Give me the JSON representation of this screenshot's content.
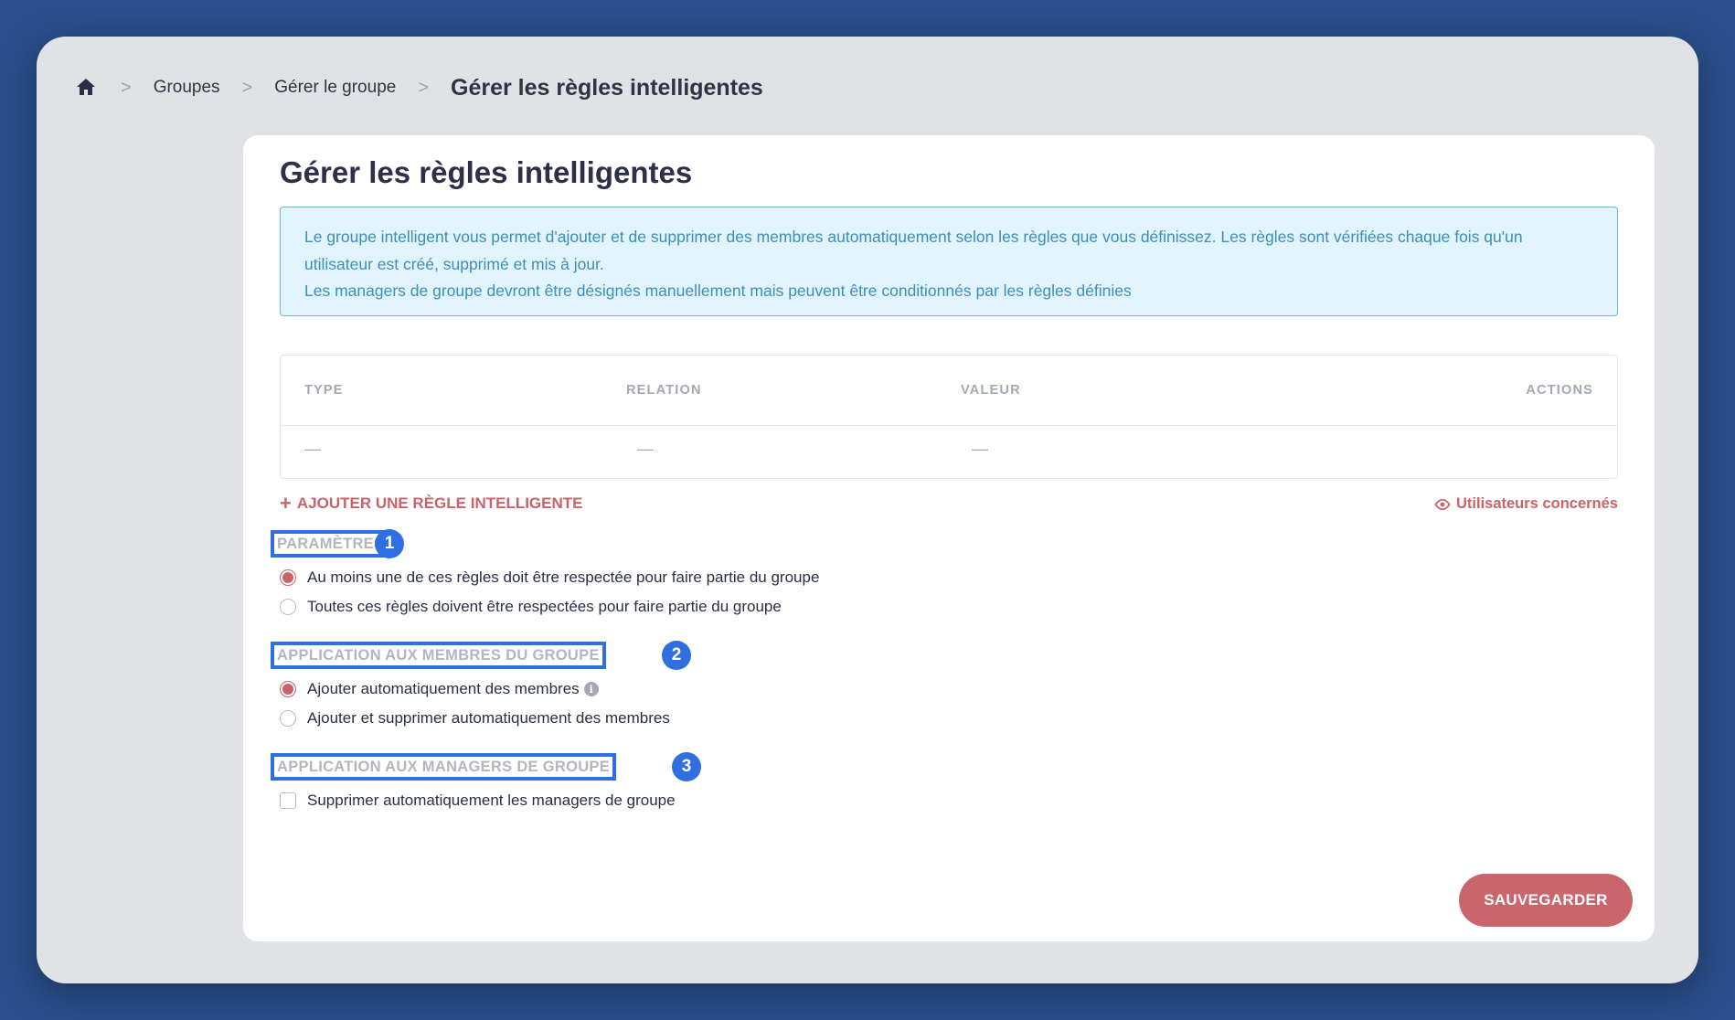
{
  "breadcrumb": {
    "items": [
      "Groupes",
      "Gérer le groupe"
    ],
    "current": "Gérer les règles intelligentes",
    "separator": ">"
  },
  "page": {
    "title": "Gérer les règles intelligentes",
    "info_lines": [
      "Le groupe intelligent vous permet d'ajouter et de supprimer des membres automatiquement selon les règles que vous définissez. Les règles sont vérifiées chaque fois qu'un utilisateur est créé, supprimé et mis à jour.",
      "Les managers de groupe devront être désignés manuellement mais peuvent être conditionnés par les règles définies"
    ]
  },
  "table": {
    "headers": [
      "TYPE",
      "RELATION",
      "VALEUR",
      "ACTIONS"
    ],
    "empty_row": [
      "—",
      "—",
      "—"
    ]
  },
  "actions": {
    "add_rule": "+ AJOUTER UNE RÈGLE INTELLIGENTE",
    "add_rule_text": "AJOUTER UNE RÈGLE INTELLIGENTE",
    "users_concerned": "Utilisateurs concernés",
    "save": "SAUVEGARDER"
  },
  "sections": [
    {
      "label": "PARAMÈTRES",
      "badge": "1",
      "options": [
        {
          "type": "radio",
          "label": "Au moins une de ces règles doit être respectée pour faire partie du groupe",
          "checked": true
        },
        {
          "type": "radio",
          "label": "Toutes ces règles doivent être respectées pour faire partie du groupe",
          "checked": false
        }
      ]
    },
    {
      "label": "APPLICATION AUX MEMBRES DU GROUPE",
      "badge": "2",
      "options": [
        {
          "type": "radio",
          "label": "Ajouter automatiquement des membres",
          "checked": true,
          "info_icon": true
        },
        {
          "type": "radio",
          "label": "Ajouter et supprimer automatiquement des membres",
          "checked": false
        }
      ]
    },
    {
      "label": "APPLICATION AUX MANAGERS DE GROUPE",
      "badge": "3",
      "options": [
        {
          "type": "checkbox",
          "label": "Supprimer automatiquement les managers de groupe",
          "checked": false
        }
      ]
    }
  ],
  "colors": {
    "background": "#2b4f8c",
    "window": "#e1e2e5",
    "accent": "#c9636a",
    "highlight": "#2f6fe0",
    "info_bg": "#e2f4fb",
    "info_text": "#3c8fb8"
  },
  "icons": [
    "home-icon",
    "chevron-right-icon",
    "eye-icon",
    "info-icon"
  ]
}
